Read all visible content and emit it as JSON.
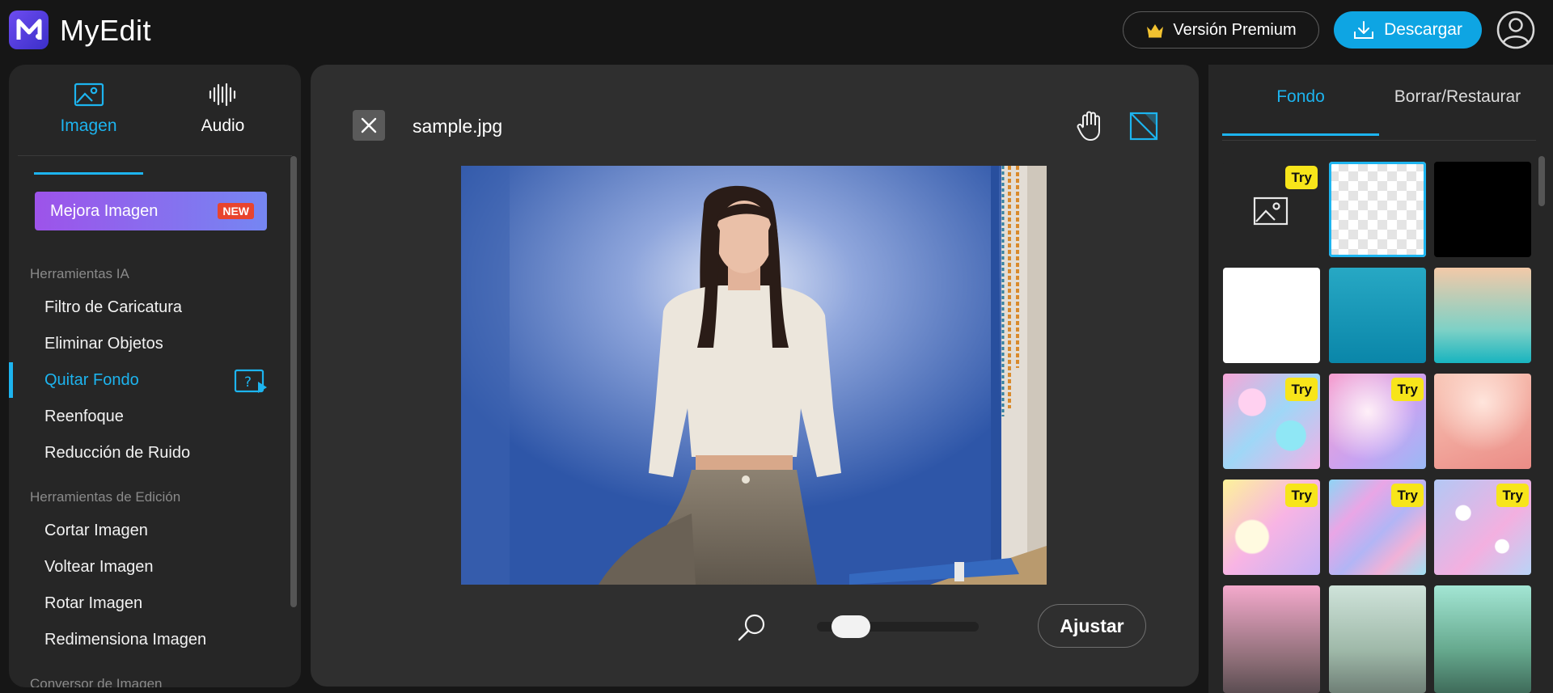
{
  "app": {
    "name": "MyEdit",
    "premium_label": "Versión Premium",
    "download_label": "Descargar"
  },
  "sidebar": {
    "modes": [
      {
        "label": "Imagen",
        "active": true
      },
      {
        "label": "Audio",
        "active": false
      }
    ],
    "mejora_label": "Mejora Imagen",
    "new_badge": "NEW",
    "sections": [
      {
        "title": "Herramientas IA",
        "items": [
          "Filtro de Caricatura",
          "Eliminar Objetos",
          "Quitar Fondo",
          "Reenfoque",
          "Reducción de Ruido"
        ]
      },
      {
        "title": "Herramientas de Edición",
        "items": [
          "Cortar Imagen",
          "Voltear Imagen",
          "Rotar Imagen",
          "Redimensiona Imagen"
        ]
      },
      {
        "title": "Conversor de Imagen",
        "items": []
      }
    ],
    "active_item": "Quitar Fondo"
  },
  "editor": {
    "filename": "sample.jpg",
    "zoom_fraction": 0.12,
    "ajustar_label": "Ajustar"
  },
  "right_panel": {
    "tabs": [
      {
        "label": "Fondo",
        "active": true
      },
      {
        "label": "Borrar/Restaurar",
        "active": false
      }
    ],
    "try_label": "Try",
    "selected_index": 1,
    "backgrounds": [
      {
        "kind": "upload",
        "try": true
      },
      {
        "kind": "transparent",
        "try": false
      },
      {
        "kind": "black",
        "try": false
      },
      {
        "kind": "white",
        "try": false
      },
      {
        "kind": "teal",
        "try": false
      },
      {
        "kind": "peach-teal",
        "try": false
      },
      {
        "kind": "bubbles",
        "try": true
      },
      {
        "kind": "pink-glitter",
        "try": true
      },
      {
        "kind": "rose-glitter",
        "try": false
      },
      {
        "kind": "pastel-bokeh",
        "try": true
      },
      {
        "kind": "holographic",
        "try": true
      },
      {
        "kind": "sparkle-bokeh",
        "try": true
      },
      {
        "kind": "pink-fade",
        "try": false
      },
      {
        "kind": "mint-fade",
        "try": false
      },
      {
        "kind": "green-fade",
        "try": false
      }
    ]
  }
}
